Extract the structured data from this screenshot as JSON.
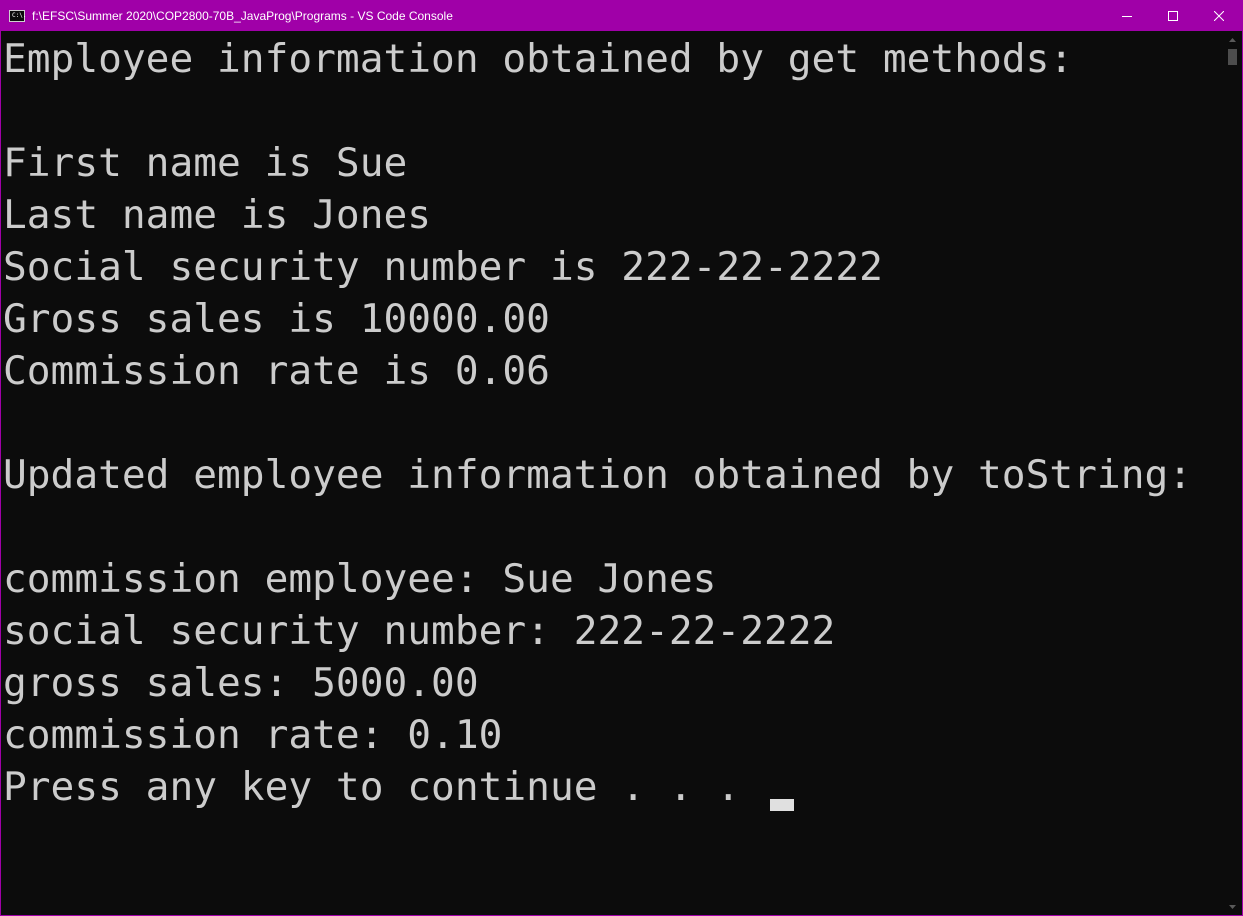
{
  "window": {
    "title": "f:\\EFSC\\Summer 2020\\COP2800-70B_JavaProg\\Programs - VS Code Console",
    "icon_label": "C:\\.",
    "accent_color": "#a000a8"
  },
  "console": {
    "lines": [
      "Employee information obtained by get methods:",
      "",
      "First name is Sue",
      "Last name is Jones",
      "Social security number is 222-22-2222",
      "Gross sales is 10000.00",
      "Commission rate is 0.06",
      "",
      "Updated employee information obtained by toString:",
      "",
      "commission employee: Sue Jones",
      "social security number: 222-22-2222",
      "gross sales: 5000.00",
      "commission rate: 0.10",
      "Press any key to continue . . . "
    ],
    "text_color": "#cccccc",
    "background_color": "#0c0c0c"
  },
  "icons": {
    "minimize": "minimize-icon",
    "maximize": "maximize-icon",
    "close": "close-icon",
    "scroll_up": "chevron-up-icon",
    "scroll_down": "chevron-down-icon"
  }
}
